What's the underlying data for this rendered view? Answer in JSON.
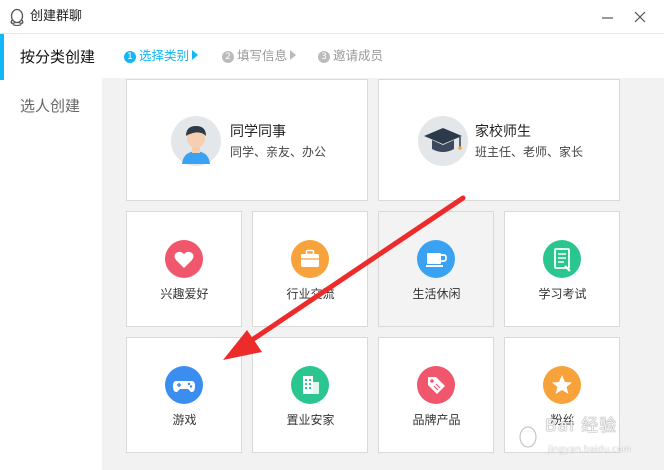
{
  "window": {
    "title": "创建群聊"
  },
  "sidebar": {
    "items": [
      {
        "label": "按分类创建",
        "active": true
      },
      {
        "label": "选人创建",
        "active": false
      }
    ]
  },
  "steps": [
    {
      "num": "1",
      "label": "选择类别",
      "active": true
    },
    {
      "num": "2",
      "label": "填写信息",
      "active": false
    },
    {
      "num": "3",
      "label": "邀请成员",
      "active": false
    }
  ],
  "big_cards": [
    {
      "title": "同学同事",
      "subtitle": "同学、亲友、办公",
      "icon": "student-avatar-icon"
    },
    {
      "title": "家校师生",
      "subtitle": "班主任、老师、家长",
      "icon": "graduation-cap-icon"
    }
  ],
  "small_cards": [
    {
      "label": "兴趣爱好",
      "icon": "heart-icon",
      "color": "#f0566c"
    },
    {
      "label": "行业交流",
      "icon": "briefcase-icon",
      "color": "#f7a23a"
    },
    {
      "label": "生活休闲",
      "icon": "coffee-cup-icon",
      "color": "#3aa2f2"
    },
    {
      "label": "学习考试",
      "icon": "notebook-icon",
      "color": "#2bc690"
    },
    {
      "label": "游戏",
      "icon": "gamepad-icon",
      "color": "#3b8df0"
    },
    {
      "label": "置业安家",
      "icon": "building-icon",
      "color": "#2bc690"
    },
    {
      "label": "品牌产品",
      "icon": "price-tag-icon",
      "color": "#f0566c"
    },
    {
      "label": "粉丝",
      "icon": "star-icon",
      "color": "#f7a23a"
    }
  ],
  "watermark": {
    "text": "Bai 经验",
    "url": "jingyan.baidu.com"
  }
}
